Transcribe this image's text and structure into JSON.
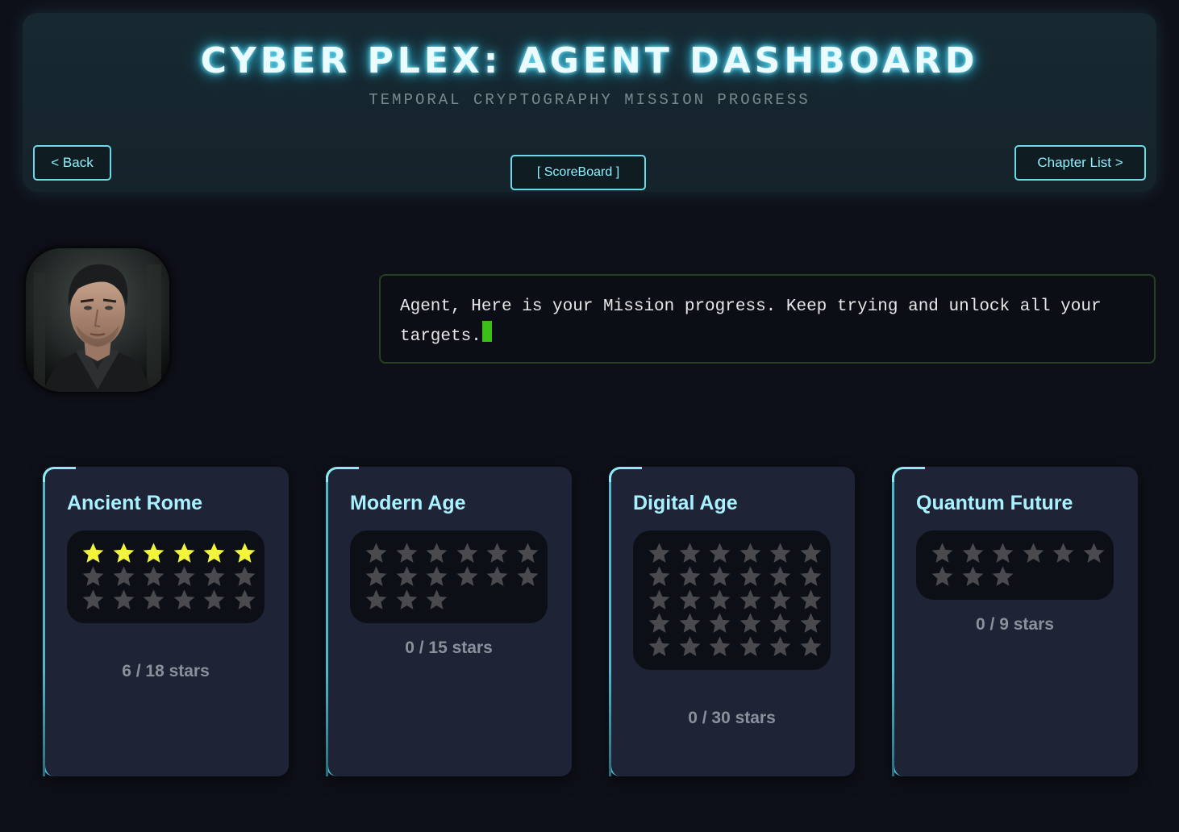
{
  "header": {
    "title": "CYBER PLEX: AGENT DASHBOARD",
    "subtitle": "TEMPORAL CRYPTOGRAPHY MISSION PROGRESS",
    "back_label": "< Back",
    "scoreboard_label": "[ ScoreBoard ]",
    "chapter_list_label": "Chapter List >"
  },
  "message": {
    "text": "Agent, Here is your Mission progress. Keep trying and unlock all your targets."
  },
  "colors": {
    "accent": "#68dce8",
    "star_filled": "#f2f53a",
    "star_empty": "#4a4a4e",
    "cursor": "#3bbf18"
  },
  "chapters": [
    {
      "title": "Ancient Rome",
      "earned": 6,
      "total": 18,
      "count_label": "6 / 18 stars"
    },
    {
      "title": "Modern Age",
      "earned": 0,
      "total": 15,
      "count_label": "0 / 15 stars"
    },
    {
      "title": "Digital Age",
      "earned": 0,
      "total": 30,
      "count_label": "0 / 30 stars"
    },
    {
      "title": "Quantum Future",
      "earned": 0,
      "total": 9,
      "count_label": "0 / 9 stars"
    }
  ]
}
